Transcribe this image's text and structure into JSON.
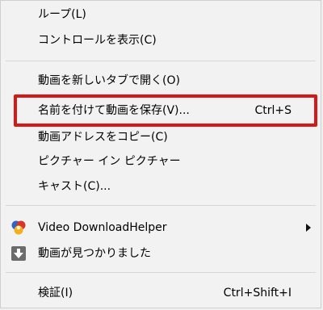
{
  "menu": {
    "items": [
      {
        "label": "ループ(L)"
      },
      {
        "label": "コントロールを表示(C)"
      },
      {
        "label": "動画を新しいタブで開く(O)"
      },
      {
        "label": "名前を付けて動画を保存(V)...",
        "shortcut": "Ctrl+S"
      },
      {
        "label": "動画アドレスをコピー(C)"
      },
      {
        "label": "ピクチャー イン ピクチャー"
      },
      {
        "label": "キャスト(C)..."
      },
      {
        "label": "Video DownloadHelper",
        "icon": "video-downloadhelper-icon"
      },
      {
        "label": "動画が見つかりました",
        "icon": "download-arrow-icon"
      },
      {
        "label": "検証(I)",
        "shortcut": "Ctrl+Shift+I"
      }
    ]
  },
  "colors": {
    "highlight_border": "#d71818",
    "background": "#f2f2f2"
  }
}
